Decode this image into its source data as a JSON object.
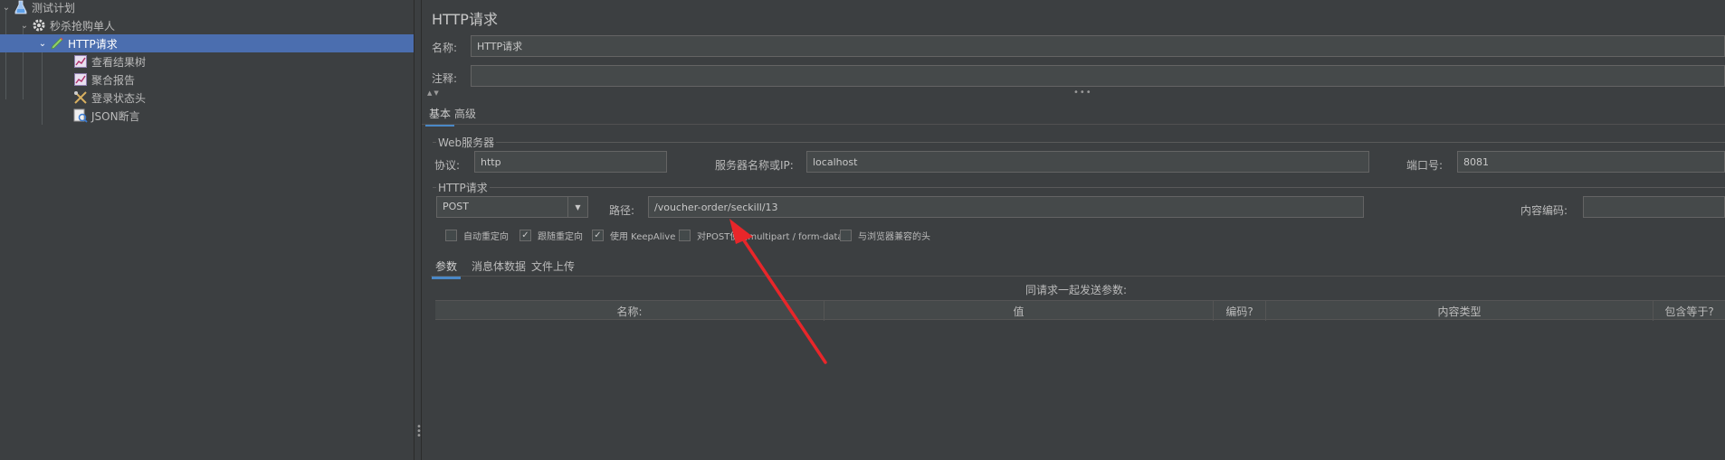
{
  "tree": {
    "items": [
      {
        "label": "测试计划",
        "icon": "test-plan-icon"
      },
      {
        "label": "秒杀抢购单人",
        "icon": "thread-group-gear-icon"
      },
      {
        "label": "HTTP请求",
        "icon": "http-sampler-pen-icon"
      },
      {
        "label": "查看结果树",
        "icon": "listener-chart-icon"
      },
      {
        "label": "聚合报告",
        "icon": "listener-chart-icon"
      },
      {
        "label": "登录状态头",
        "icon": "header-manager-tools-icon"
      },
      {
        "label": "JSON断言",
        "icon": "json-assertion-icon"
      }
    ]
  },
  "panel": {
    "title": "HTTP请求",
    "name_label": "名称:",
    "name_value": "HTTP请求",
    "comment_label": "注释:",
    "comment_value": "",
    "tabs": [
      "基本",
      "高级"
    ],
    "web_server": {
      "group_label": "Web服务器",
      "protocol_label": "协议:",
      "protocol_value": "http",
      "server_label": "服务器名称或IP:",
      "server_value": "localhost",
      "port_label": "端口号:",
      "port_value": "8081"
    },
    "http_request": {
      "group_label": "HTTP请求",
      "method_value": "POST",
      "path_label": "路径:",
      "path_value": "/voucher-order/seckill/13",
      "encoding_label": "内容编码:",
      "encoding_value": ""
    },
    "checkboxes": [
      {
        "label": "自动重定向",
        "checked": false
      },
      {
        "label": "跟随重定向",
        "checked": true
      },
      {
        "label": "使用 KeepAlive",
        "checked": true
      },
      {
        "label": "对POST使用multipart / form-data",
        "checked": false
      },
      {
        "label": "与浏览器兼容的头",
        "checked": false
      }
    ],
    "sub_tabs": [
      "参数",
      "消息体数据",
      "文件上传"
    ],
    "params_caption": "同请求一起发送参数:",
    "columns": [
      "名称:",
      "值",
      "编码?",
      "内容类型",
      "包含等于?"
    ]
  },
  "colors": {
    "background": "#3c3f41",
    "selection": "#4b6eaf",
    "annotation_arrow": "#e8262a",
    "tab_accent": "#4a88c7"
  }
}
